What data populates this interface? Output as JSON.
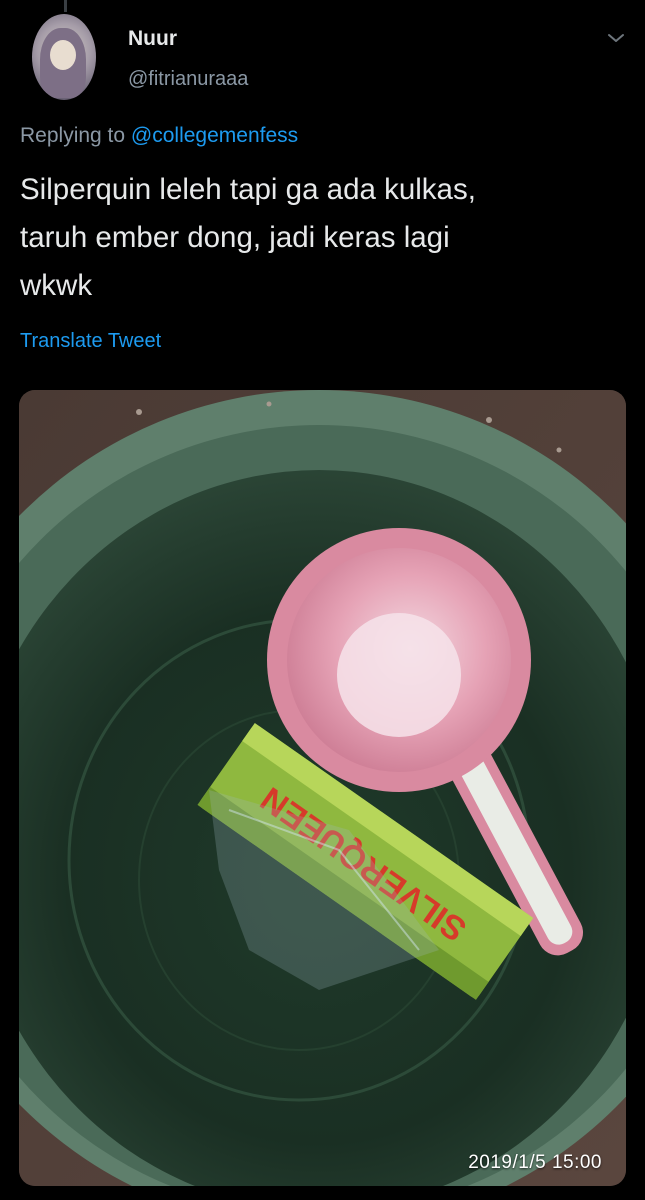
{
  "tweet": {
    "display_name": "Nuur",
    "handle": "@fitrianuraaa",
    "replying_prefix": "Replying to ",
    "replying_to": "@collegemenfess",
    "text_lines": [
      "Silperquin leleh tapi ga ada kulkas,",
      "taruh ember dong, jadi keras lagi",
      "wkwk"
    ],
    "translate_label": "Translate Tweet",
    "media": {
      "timestamp": "2019/1/5  15:00",
      "product_label": "SILVERQUEEN"
    },
    "icons": {
      "more": "chevron-down-icon"
    }
  },
  "colors": {
    "background": "#000000",
    "primary_text": "#e7e9ea",
    "secondary_text": "#8b98a5",
    "link": "#1d9bf0"
  }
}
